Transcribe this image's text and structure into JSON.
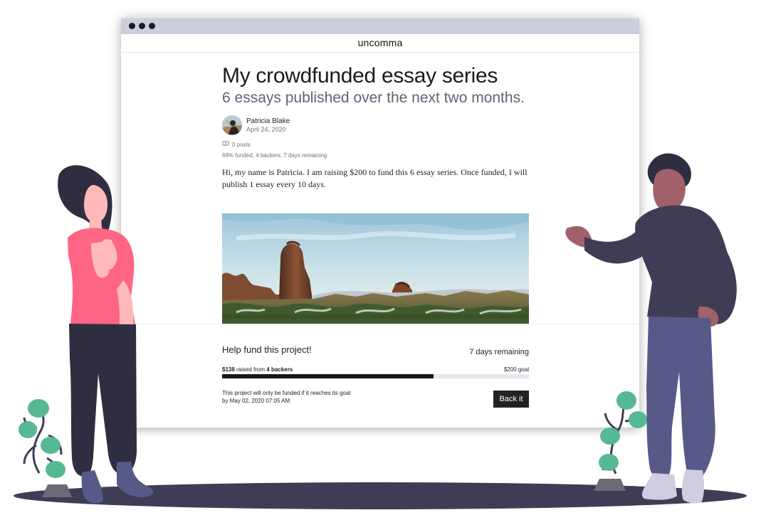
{
  "site": {
    "name": "uncomma"
  },
  "article": {
    "title": "My crowdfunded essay series",
    "subtitle": "6 essays published over the next two months.",
    "author_name": "Patricia Blake",
    "date": "April 24, 2020",
    "posts_icon": "book-icon",
    "posts_count": "0 posts",
    "funding_summary": "69% funded, 4 backers, 7 days remaining",
    "intro": "Hi, my name is Patricia. I am raising $200 to fund this 6 essay series. Once funded, I will publish 1 essay every 10 days."
  },
  "fund_panel": {
    "heading": "Help fund this project!",
    "days_remaining": "7 days remaining",
    "raised_amount": "$138",
    "raised_middle": " raised from ",
    "backers": "4 backers",
    "goal": "$200 goal",
    "progress": 0.69,
    "deadline_line_1": "This project will only be funded if it reaches its goal",
    "deadline_line_2": "by May 02, 2020 07:05 AM",
    "button_label": "Back it"
  },
  "colors": {
    "browser_bar": "#cbcedc",
    "browser_dots": "#1b1b23",
    "title": "#1b1b1f",
    "subtitle": "#5d6373",
    "progress_fill": "#17171b",
    "progress_track": "#e5e8ee",
    "button": "#222226",
    "ground": "#3f3d56",
    "woman_shirt": "#ff6584",
    "pants": "#3f3d56",
    "man_pants": "#575a89",
    "plant": "#57b894"
  }
}
